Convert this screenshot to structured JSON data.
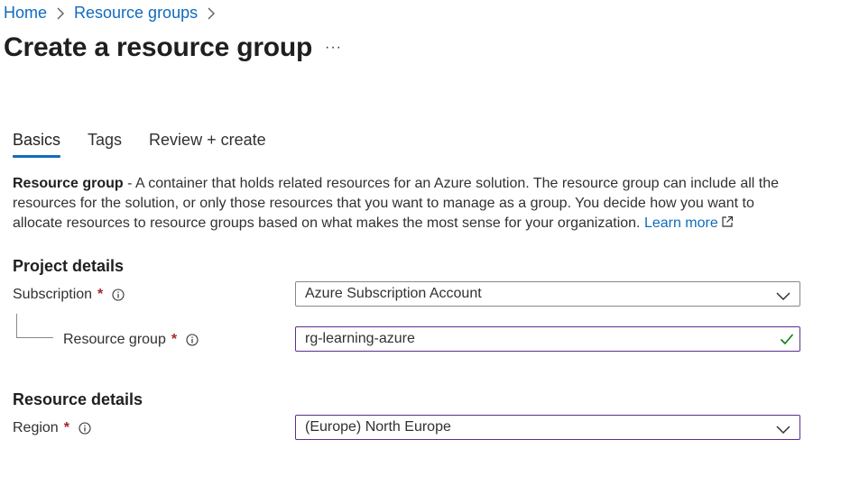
{
  "breadcrumb": {
    "home": "Home",
    "resource_groups": "Resource groups"
  },
  "page": {
    "title": "Create a resource group",
    "more": "···"
  },
  "tabs": [
    {
      "label": "Basics",
      "active": true
    },
    {
      "label": "Tags",
      "active": false
    },
    {
      "label": "Review + create",
      "active": false
    }
  ],
  "description": {
    "term": "Resource group",
    "text": " - A container that holds related resources for an Azure solution. The resource group can include all the resources for the solution, or only those resources that you want to manage as a group. You decide how you want to allocate resources to resource groups based on what makes the most sense for your organization. ",
    "learn_more": "Learn more"
  },
  "project_details": {
    "title": "Project details",
    "subscription_label": "Subscription",
    "subscription_value": "Azure Subscription Account",
    "resource_group_label": "Resource group",
    "resource_group_value": "rg-learning-azure"
  },
  "resource_details": {
    "title": "Resource details",
    "region_label": "Region",
    "region_value": "(Europe) North Europe"
  },
  "required_marker": "*",
  "colors": {
    "link": "#0f6cbd",
    "required": "#a4262c",
    "valid": "#107c10",
    "focus_border": "#5c2d91"
  },
  "icons": [
    "chevron-right-icon",
    "info-icon",
    "chevron-down-icon",
    "checkmark-icon",
    "external-link-icon",
    "more-icon"
  ]
}
